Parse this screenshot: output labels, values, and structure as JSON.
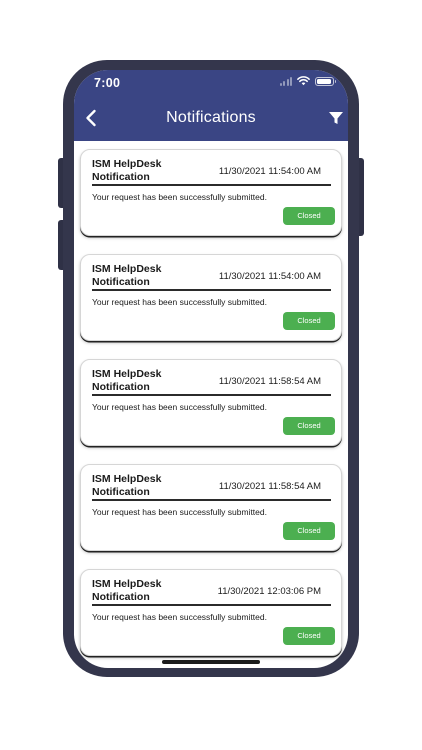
{
  "status_bar": {
    "time": "7:00"
  },
  "header": {
    "title": "Notifications",
    "background_color": "#3a4584",
    "back_icon": "chevron-left-icon",
    "filter_icon": "filter-icon"
  },
  "notifications": [
    {
      "title": "ISM HelpDesk Notification",
      "timestamp": "11/30/2021 11:54:00 AM",
      "message": "Your request has been successfully submitted.",
      "status": "Closed"
    },
    {
      "title": "ISM HelpDesk Notification",
      "timestamp": "11/30/2021 11:54:00 AM",
      "message": "Your request has been successfully submitted.",
      "status": "Closed"
    },
    {
      "title": "ISM HelpDesk Notification",
      "timestamp": "11/30/2021 11:58:54 AM",
      "message": "Your request has been successfully submitted.",
      "status": "Closed"
    },
    {
      "title": "ISM HelpDesk Notification",
      "timestamp": "11/30/2021 11:58:54 AM",
      "message": "Your request has been successfully submitted.",
      "status": "Closed"
    },
    {
      "title": "ISM HelpDesk Notification",
      "timestamp": "11/30/2021 12:03:06 PM",
      "message": "Your request has been successfully submitted.",
      "status": "Closed"
    }
  ],
  "colors": {
    "status_closed": "#4caf50",
    "phone_frame": "#34364c"
  }
}
